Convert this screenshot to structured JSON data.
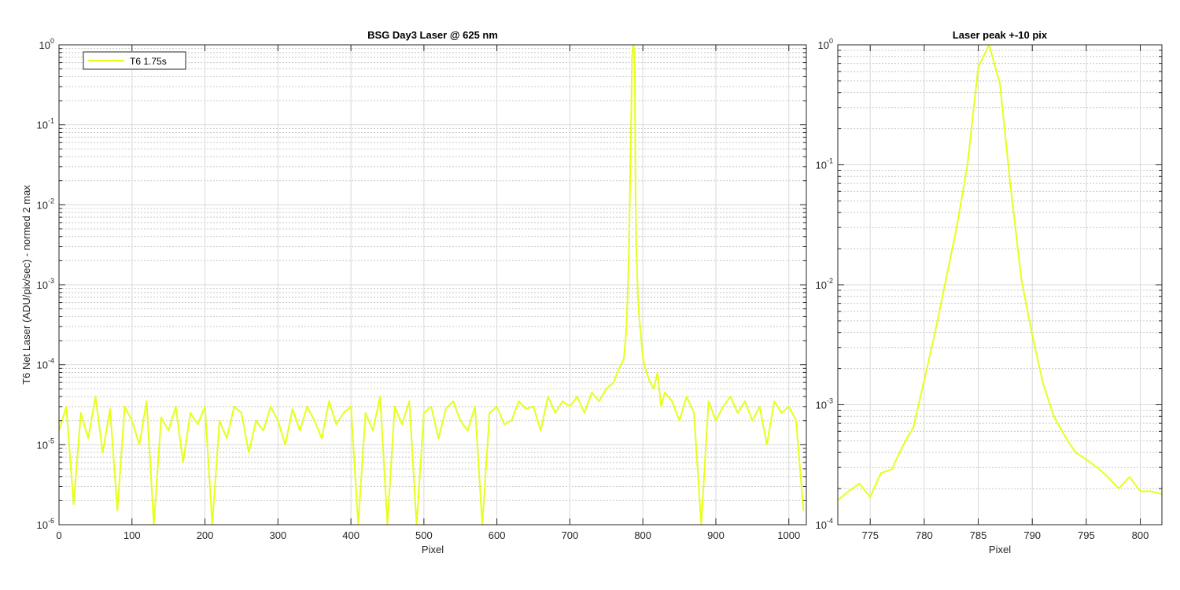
{
  "chart_data": [
    {
      "type": "line",
      "title": "BSG  Day3 Laser @ 625 nm",
      "xlabel": "Pixel",
      "ylabel": "T6 Net Laser (ADU/pix/sec) - normed 2 max",
      "xlim": [
        0,
        1024
      ],
      "ylim": [
        1e-06,
        1
      ],
      "yscale": "log",
      "grid": true,
      "minor_grid": true,
      "legend_location": "top-left",
      "xticks": [
        0,
        100,
        200,
        300,
        400,
        500,
        600,
        700,
        800,
        900,
        1000
      ],
      "xtick_labels": [
        "0",
        "100",
        "200",
        "300",
        "400",
        "500",
        "600",
        "700",
        "800",
        "900",
        "1000"
      ],
      "yticks": [
        {
          "base": "10",
          "exp": "-6"
        },
        {
          "base": "10",
          "exp": "-5"
        },
        {
          "base": "10",
          "exp": "-4"
        },
        {
          "base": "10",
          "exp": "-3"
        },
        {
          "base": "10",
          "exp": "-2"
        },
        {
          "base": "10",
          "exp": "-1"
        },
        {
          "base": "10",
          "exp": "0"
        }
      ],
      "series": [
        {
          "name": "T6 1.75s",
          "color": "#e6ff1a",
          "x": [
            0,
            10,
            20,
            30,
            40,
            50,
            60,
            70,
            80,
            90,
            100,
            110,
            120,
            130,
            140,
            150,
            160,
            170,
            180,
            190,
            200,
            210,
            220,
            230,
            240,
            250,
            260,
            270,
            280,
            290,
            300,
            310,
            320,
            330,
            340,
            350,
            360,
            370,
            380,
            390,
            400,
            410,
            420,
            430,
            440,
            450,
            460,
            470,
            480,
            490,
            500,
            510,
            520,
            530,
            540,
            550,
            560,
            570,
            580,
            590,
            600,
            610,
            620,
            630,
            640,
            650,
            660,
            670,
            680,
            690,
            700,
            710,
            720,
            730,
            740,
            750,
            760,
            765,
            770,
            774,
            777,
            779,
            781,
            783,
            784,
            785,
            786,
            787,
            788,
            789,
            790,
            791,
            793,
            795,
            797,
            800,
            805,
            810,
            815,
            820,
            825,
            830,
            840,
            850,
            860,
            870,
            880,
            890,
            900,
            910,
            920,
            930,
            940,
            950,
            960,
            970,
            980,
            990,
            1000,
            1010,
            1020
          ],
          "y": [
            1.5e-05,
            3e-05,
            1.8e-06,
            2.5e-05,
            1.2e-05,
            4e-05,
            8e-06,
            2.8e-05,
            1.5e-06,
            3e-05,
            2e-05,
            1e-05,
            3.5e-05,
            1e-06,
            2.2e-05,
            1.5e-05,
            3e-05,
            6e-06,
            2.5e-05,
            1.8e-05,
            3e-05,
            1e-06,
            2e-05,
            1.2e-05,
            3e-05,
            2.5e-05,
            8e-06,
            2e-05,
            1.5e-05,
            3e-05,
            2e-05,
            1e-05,
            2.8e-05,
            1.5e-05,
            3e-05,
            2e-05,
            1.2e-05,
            3.5e-05,
            1.8e-05,
            2.5e-05,
            3e-05,
            1e-06,
            2.5e-05,
            1.5e-05,
            4e-05,
            1e-06,
            3e-05,
            1.8e-05,
            3.5e-05,
            1e-06,
            2.5e-05,
            3e-05,
            1.2e-05,
            2.8e-05,
            3.5e-05,
            2e-05,
            1.5e-05,
            3e-05,
            1e-06,
            2.5e-05,
            3e-05,
            1.8e-05,
            2e-05,
            3.5e-05,
            2.8e-05,
            3e-05,
            1.5e-05,
            4e-05,
            2.5e-05,
            3.5e-05,
            3e-05,
            4e-05,
            2.5e-05,
            4.5e-05,
            3.5e-05,
            5e-05,
            6e-05,
            8e-05,
            0.0001,
            0.00012,
            0.00025,
            0.00065,
            0.003,
            0.035,
            0.12,
            0.65,
            0.9,
            1.0,
            0.85,
            0.45,
            0.012,
            0.003,
            0.0008,
            0.0004,
            0.00025,
            0.00012,
            8e-05,
            6e-05,
            5e-05,
            8e-05,
            3e-05,
            4.5e-05,
            3.5e-05,
            2e-05,
            4e-05,
            2.5e-05,
            1e-06,
            3.5e-05,
            2e-05,
            3e-05,
            4e-05,
            2.5e-05,
            3.5e-05,
            2e-05,
            3e-05,
            1e-05,
            3.5e-05,
            2.5e-05,
            3e-05,
            2e-05,
            1.5e-06
          ]
        }
      ]
    },
    {
      "type": "line",
      "title": "Laser peak +-10 pix",
      "xlabel": "Pixel",
      "ylabel": "",
      "xlim": [
        772,
        802
      ],
      "ylim": [
        0.0001,
        1
      ],
      "yscale": "log",
      "grid": true,
      "minor_grid": true,
      "xticks": [
        775,
        780,
        785,
        790,
        795,
        800
      ],
      "xtick_labels": [
        "775",
        "780",
        "785",
        "790",
        "795",
        "800"
      ],
      "yticks": [
        {
          "base": "10",
          "exp": "-4"
        },
        {
          "base": "10",
          "exp": "-3"
        },
        {
          "base": "10",
          "exp": "-2"
        },
        {
          "base": "10",
          "exp": "-1"
        },
        {
          "base": "10",
          "exp": "0"
        }
      ],
      "series": [
        {
          "color": "#e6ff1a",
          "x": [
            772,
            773,
            774,
            775,
            776,
            777,
            778,
            779,
            780,
            781,
            782,
            783,
            784,
            785,
            786,
            787,
            788,
            789,
            790,
            791,
            792,
            793,
            794,
            795,
            796,
            797,
            798,
            799,
            800,
            801,
            802
          ],
          "y": [
            0.00016,
            0.00019,
            0.00022,
            0.00017,
            0.00027,
            0.00029,
            0.00045,
            0.00065,
            0.0016,
            0.004,
            0.011,
            0.03,
            0.1,
            0.65,
            1.0,
            0.48,
            0.065,
            0.011,
            0.0038,
            0.0015,
            0.0008,
            0.00055,
            0.0004,
            0.00035,
            0.0003,
            0.00025,
            0.0002,
            0.00025,
            0.00019,
            0.00019,
            0.00018
          ]
        }
      ]
    }
  ]
}
